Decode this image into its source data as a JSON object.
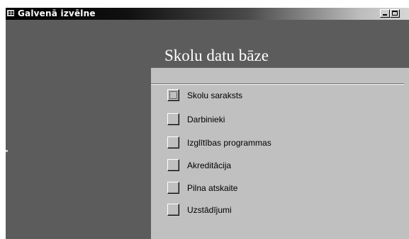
{
  "window": {
    "title": "Galvenā izvēlne",
    "icon": "form-icon",
    "controls": [
      "minimize-icon",
      "maximize-icon"
    ]
  },
  "header": {
    "title": "Skolu datu bāze"
  },
  "menu": {
    "items": [
      {
        "label": "Skolu saraksts",
        "focused": true
      },
      {
        "label": "Darbinieki"
      },
      {
        "label": "Izglītības programmas"
      },
      {
        "label": "Akreditācija"
      },
      {
        "label": "Pilna atskaite"
      },
      {
        "label": "Uzstādījumi"
      }
    ]
  },
  "colors": {
    "background_dark": "#5c5c5c",
    "panel": "#c0c0c0",
    "title_text": "#ffffff"
  }
}
